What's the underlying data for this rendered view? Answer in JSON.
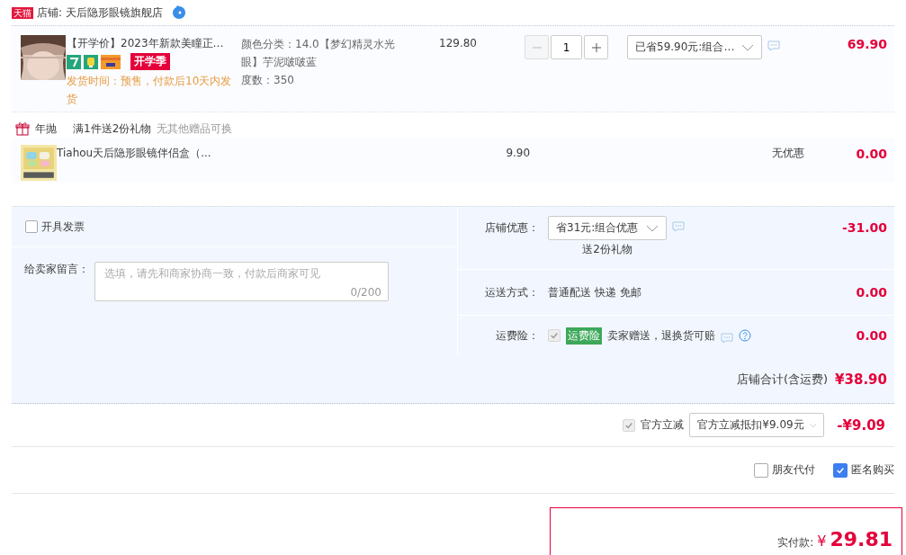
{
  "shop": {
    "badge": "天猫",
    "name": "店铺: 天后隐形眼镜旗舰店"
  },
  "items": [
    {
      "kind": "main",
      "title": "【开学价】2023年新款美瞳正…",
      "badge": "开学季",
      "delivery": "发货时间：预售，付款后10天内发货",
      "spec": "颜色分类：14.0【梦幻精灵水光眼】芋泥啵啵蓝",
      "degree": "度数：350",
      "price": "129.80",
      "quantity": "1",
      "promo": "已省59.90元:组合…",
      "total": "69.90"
    },
    {
      "kind": "gift",
      "group": "年抛",
      "offer": "满1件送2份礼物",
      "note": "无其他赠品可换",
      "title": "Tiahou天后隐形眼镜伴侣盒（...",
      "price": "9.90",
      "promo": "无优惠",
      "total": "0.00"
    }
  ],
  "invoice": {
    "label": "开具发票",
    "checked": false
  },
  "message": {
    "label": "给卖家留言：",
    "placeholder": "选填，请先和商家协商一致，付款后商家可见",
    "counter": "0/200"
  },
  "shop_discount": {
    "label": "店铺优惠：",
    "select": "省31元:组合优惠",
    "note": "送2份礼物",
    "amount": "-31.00"
  },
  "shipping": {
    "label": "运送方式：",
    "value": "普通配送 快递 免邮",
    "amount": "0.00"
  },
  "insurance": {
    "label": "运费险：",
    "checked": true,
    "disabled": true,
    "tag": "运费险",
    "text": "卖家赠送，退换货可赔",
    "amount": "0.00"
  },
  "subtotal": {
    "label": "店铺合计(含运费)",
    "amount": "¥38.90"
  },
  "official": {
    "checked": true,
    "disabled": true,
    "label": "官方立减",
    "select": "官方立减抵扣¥9.09元",
    "amount": "-¥9.09"
  },
  "options": [
    {
      "label": "朋友代付",
      "checked": false
    },
    {
      "label": "匿名购买",
      "checked": true
    }
  ],
  "payment": {
    "label": "实付款:",
    "currency": "¥",
    "amount": "29.81"
  }
}
